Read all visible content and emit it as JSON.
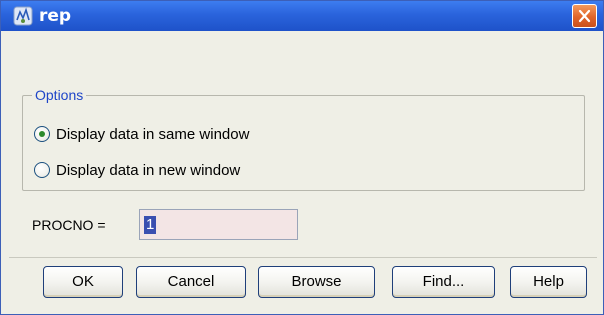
{
  "window": {
    "title": "rep"
  },
  "options": {
    "legend": "Options",
    "radio_same": {
      "label": "Display data in same window",
      "selected": true
    },
    "radio_new": {
      "label": "Display data in new window",
      "selected": false
    }
  },
  "procno": {
    "label": "PROCNO =",
    "value": "1"
  },
  "buttons": {
    "ok": "OK",
    "cancel": "Cancel",
    "browse": "Browse",
    "find": "Find...",
    "help": "Help"
  },
  "colors": {
    "titlebar": "#2a63dc",
    "close_button": "#e0642a",
    "legend_text": "#1e45c8",
    "input_background": "#f3e5e5",
    "selection": "#3a4fb0"
  },
  "icons": {
    "app": "topspin-app-icon",
    "close": "close-icon"
  }
}
